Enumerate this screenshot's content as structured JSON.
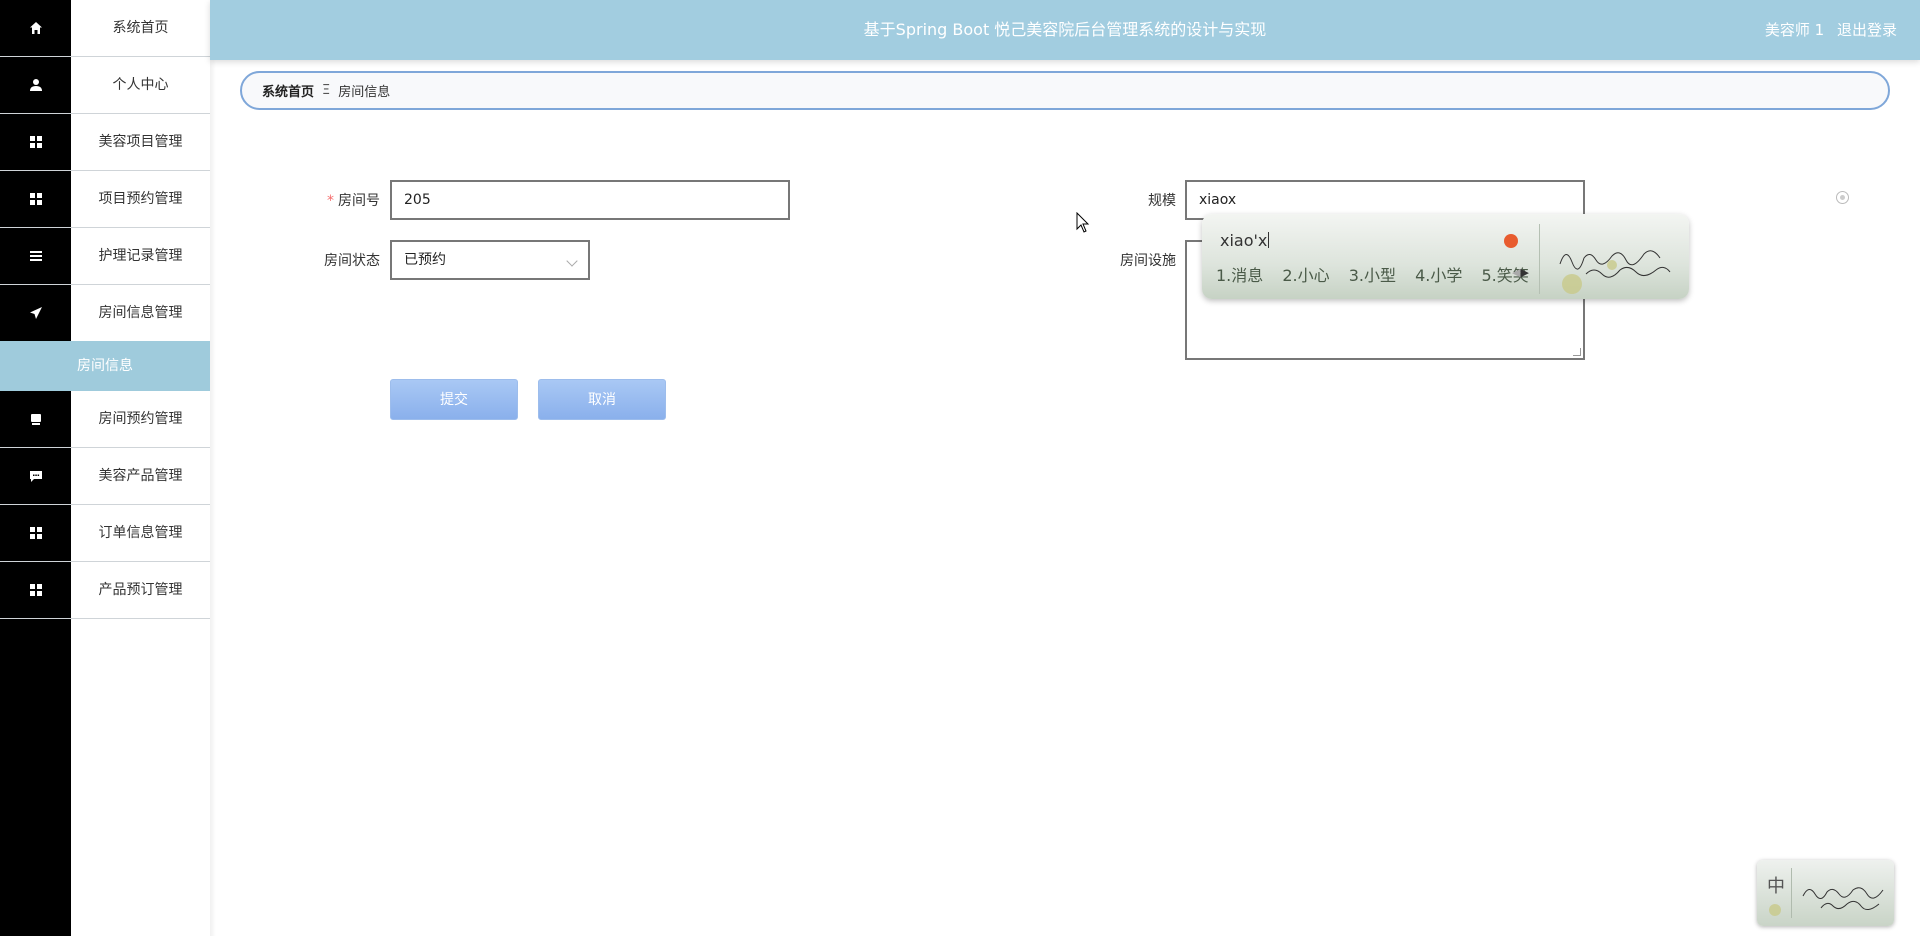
{
  "header": {
    "title": "基于Spring Boot 悦己美容院后台管理系统的设计与实现",
    "user_name": "美容师 1",
    "logout_label": "退出登录"
  },
  "sidebar": {
    "items": [
      {
        "label": "系统首页",
        "icon": "home-icon"
      },
      {
        "label": "个人中心",
        "icon": "user-icon"
      },
      {
        "label": "美容项目管理",
        "icon": "grid-icon"
      },
      {
        "label": "项目预约管理",
        "icon": "grid-icon"
      },
      {
        "label": "护理记录管理",
        "icon": "list-icon"
      },
      {
        "label": "房间信息管理",
        "icon": "send-icon"
      },
      {
        "label": "房间预约管理",
        "icon": "box-icon"
      },
      {
        "label": "美容产品管理",
        "icon": "chat-icon"
      },
      {
        "label": "订单信息管理",
        "icon": "grid-icon"
      },
      {
        "label": "产品预订管理",
        "icon": "grid-icon"
      }
    ],
    "active_sub": "房间信息"
  },
  "breadcrumb": {
    "home": "系统首页",
    "separator": "Ξ",
    "current": "房间信息"
  },
  "form": {
    "room_no_label": "房间号",
    "room_no_value": "205",
    "scale_label": "规模",
    "scale_value": "xiaox",
    "status_label": "房间状态",
    "status_value": "已预约",
    "facilities_label": "房间设施",
    "submit_label": "提交",
    "cancel_label": "取消"
  },
  "ime": {
    "composition": "xiao'x",
    "candidates": [
      "1.消息",
      "2.小心",
      "3.小型",
      "4.小学",
      "5.笑笑"
    ],
    "status_char": "中"
  },
  "colors": {
    "header_bg": "#a2cde0",
    "sidebar_icon_bg": "#000000",
    "sidebar_active_bg": "#9fcbdc",
    "button_bg": "#8ab0ec",
    "breadcrumb_border": "#7fa7d9"
  }
}
